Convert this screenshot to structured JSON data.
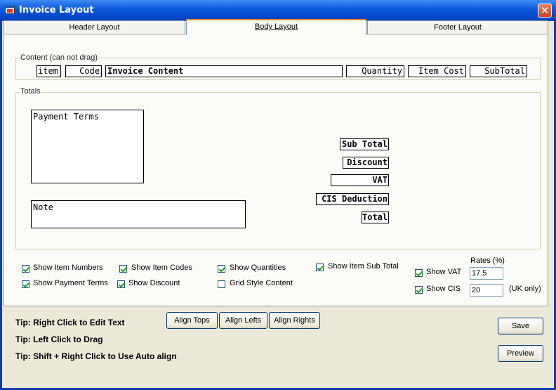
{
  "window": {
    "title": "Invoice Layout",
    "close_glyph": "✕"
  },
  "tabs": [
    {
      "label": "Header Layout",
      "active": false
    },
    {
      "label": "Body Layout",
      "active": true
    },
    {
      "label": "Footer Layout",
      "active": false
    }
  ],
  "content_group": {
    "legend": "Content (can not drag)",
    "columns": [
      "item",
      "Code",
      "Invoice Content",
      "Quantity",
      "Item Cost",
      "SubTotal"
    ]
  },
  "totals_group": {
    "legend": "Totals",
    "payment_terms": "Payment Terms",
    "note": "Note",
    "labels": [
      "Sub Total",
      "Discount",
      "VAT",
      "CIS Deduction",
      "Total"
    ]
  },
  "options": {
    "checkboxes": [
      {
        "label": "Show Item Numbers",
        "checked": true
      },
      {
        "label": "Show Item Codes",
        "checked": true
      },
      {
        "label": "Show Quantities",
        "checked": true
      },
      {
        "label": "Show Item Sub Total",
        "checked": true
      },
      {
        "label": "Show Payment Terms",
        "checked": true
      },
      {
        "label": "Show Discount",
        "checked": true
      },
      {
        "label": "Grid Style Content",
        "checked": false
      }
    ],
    "rates_label": "Rates (%)",
    "vat": {
      "label": "Show VAT",
      "checked": true,
      "value": "17.5"
    },
    "cis": {
      "label": "Show CIS",
      "checked": true,
      "value": "20",
      "note": "(UK only)"
    }
  },
  "tips": [
    "Tip: Right Click to Edit Text",
    "Tip: Left Click to Drag",
    "Tip: Shift + Right Click to Use Auto align"
  ],
  "align_buttons": [
    "Align Tops",
    "Align Lefts",
    "Align Rights"
  ],
  "actions": {
    "save": "Save",
    "preview": "Preview"
  },
  "colors": {
    "titlebar": "#0a58d8",
    "close": "#c9401f",
    "active_tab_accent": "#e68b2c",
    "check": "#21a121"
  }
}
